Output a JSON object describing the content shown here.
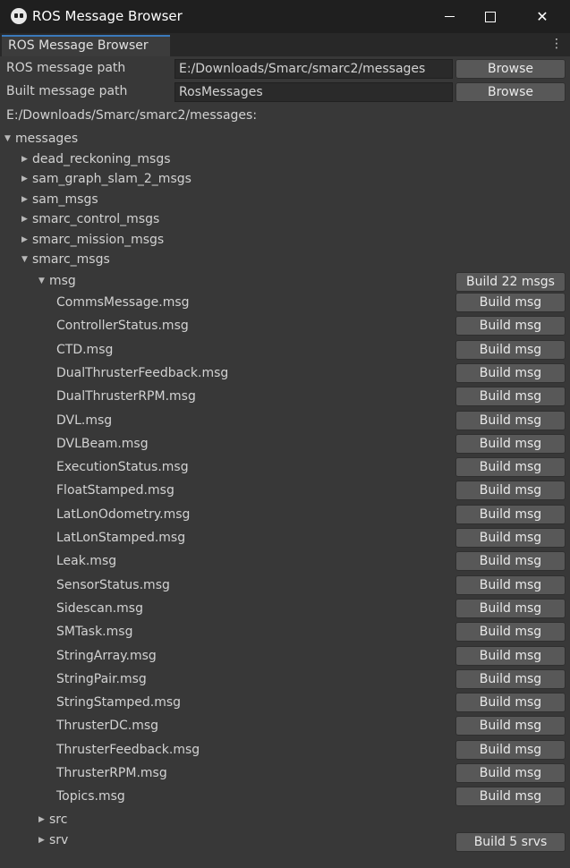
{
  "window": {
    "title": "ROS Message Browser"
  },
  "tab": {
    "label": "ROS Message Browser"
  },
  "form": {
    "ros_path_label": "ROS message path",
    "ros_path_value": "E:/Downloads/Smarc/smarc2/messages",
    "built_path_label": "Built message path",
    "built_path_value": "RosMessages",
    "browse_label": "Browse",
    "current_path": "E:/Downloads/Smarc/smarc2/messages:"
  },
  "tree": {
    "root": "messages",
    "packages": [
      "dead_reckoning_msgs",
      "sam_graph_slam_2_msgs",
      "sam_msgs",
      "smarc_control_msgs",
      "smarc_mission_msgs",
      "smarc_msgs"
    ],
    "msg_folder": "msg",
    "build_all_msgs": "Build 22 msgs",
    "build_msg": "Build msg",
    "files": [
      "CommsMessage.msg",
      "ControllerStatus.msg",
      "CTD.msg",
      "DualThrusterFeedback.msg",
      "DualThrusterRPM.msg",
      "DVL.msg",
      "DVLBeam.msg",
      "ExecutionStatus.msg",
      "FloatStamped.msg",
      "LatLonOdometry.msg",
      "LatLonStamped.msg",
      "Leak.msg",
      "SensorStatus.msg",
      "Sidescan.msg",
      "SMTask.msg",
      "StringArray.msg",
      "StringPair.msg",
      "StringStamped.msg",
      "ThrusterDC.msg",
      "ThrusterFeedback.msg",
      "ThrusterRPM.msg",
      "Topics.msg"
    ],
    "src_folder": "src",
    "srv_folder": "srv",
    "build_all_srvs": "Build 5 srvs"
  },
  "icons": {
    "collapsed": "triangle-right",
    "expanded": "triangle-down"
  }
}
